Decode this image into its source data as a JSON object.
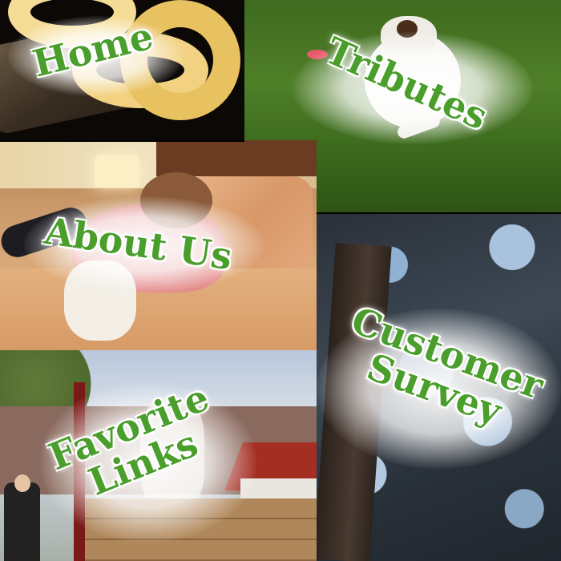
{
  "nav": {
    "home": {
      "label": "Home"
    },
    "tributes": {
      "label": "Tributes"
    },
    "about": {
      "label": "About Us"
    },
    "survey": {
      "line1": "Customer",
      "line2": "Survey"
    },
    "favorites": {
      "line1": "Favorite",
      "line2": "Links"
    }
  },
  "colors": {
    "label_text": "#4a9e2c",
    "glow": "#ffffff"
  },
  "icons": {
    "home_photo": "python-snake-photo",
    "tributes_photo": "jumping-dog-photo",
    "about_photo": "woman-with-dog-photo",
    "survey_photo": "dog-in-tree-photo",
    "favorites_photo": "dog-at-fence-photo"
  }
}
